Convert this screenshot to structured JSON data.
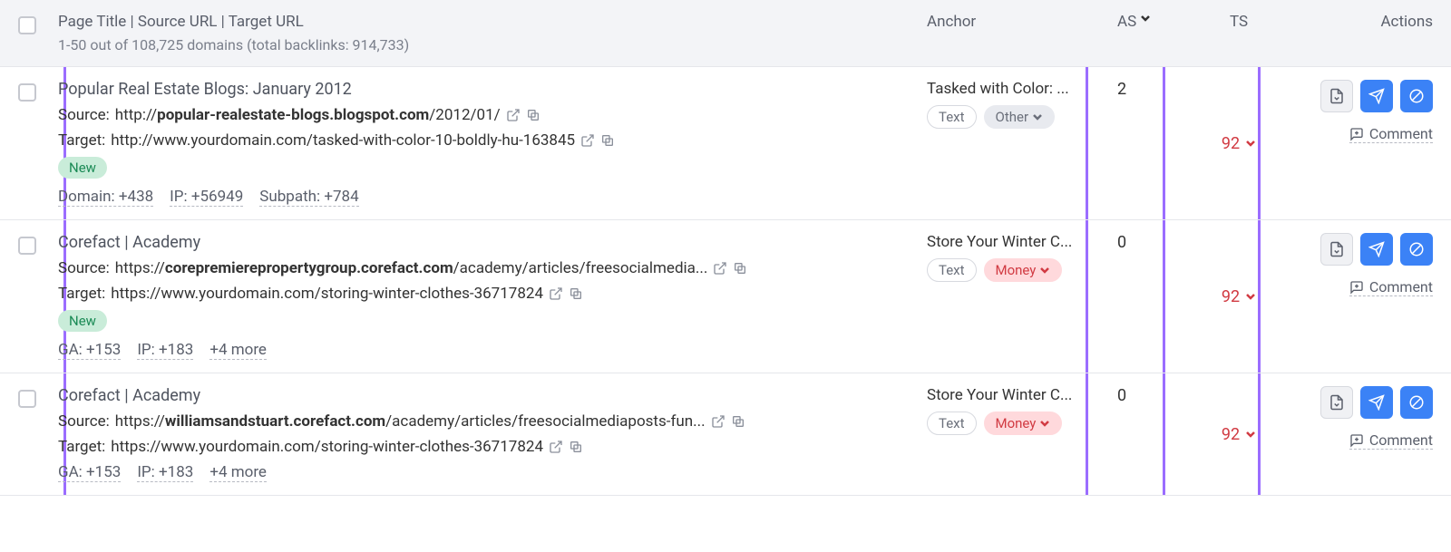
{
  "header": {
    "main_title": "Page Title | Source URL | Target URL",
    "sub": "1-50 out of 108,725 domains (total backlinks: 914,733)",
    "anchor": "Anchor",
    "as": "AS",
    "ts": "TS",
    "actions": "Actions"
  },
  "labels": {
    "source": "Source:",
    "target": "Target:",
    "new": "New",
    "comment": "Comment",
    "text_tag": "Text",
    "other_tag": "Other",
    "money_tag": "Money"
  },
  "rows": [
    {
      "title": "Popular Real Estate Blogs: January 2012",
      "source_pre": "http://",
      "source_bold": "popular-realestate-blogs.blogspot.com",
      "source_post": "/2012/01/",
      "target": "http://www.yourdomain.com/tasked-with-color-10-boldly-hu-163845",
      "new": true,
      "stats": [
        "Domain: +438",
        "IP: +56949",
        "Subpath: +784"
      ],
      "anchor": "Tasked with Color: ...",
      "tag2": "other",
      "as": "2",
      "ts": "92"
    },
    {
      "title": "Corefact | Academy",
      "source_pre": "https://",
      "source_bold": "corepremierepropertygroup.corefact.com",
      "source_post": "/academy/articles/freesocialmedia...",
      "target": "https://www.yourdomain.com/storing-winter-clothes-36717824",
      "new": true,
      "stats": [
        "GA: +153",
        "IP: +183",
        "+4 more"
      ],
      "anchor": "Store Your Winter C...",
      "tag2": "money",
      "as": "0",
      "ts": "92"
    },
    {
      "title": "Corefact | Academy",
      "source_pre": "https://",
      "source_bold": "williamsandstuart.corefact.com",
      "source_post": "/academy/articles/freesocialmediaposts-fun...",
      "target": "https://www.yourdomain.com/storing-winter-clothes-36717824",
      "new": false,
      "stats": [
        "GA: +153",
        "IP: +183",
        "+4 more"
      ],
      "anchor": "Store Your Winter C...",
      "tag2": "money",
      "as": "0",
      "ts": "92"
    }
  ]
}
